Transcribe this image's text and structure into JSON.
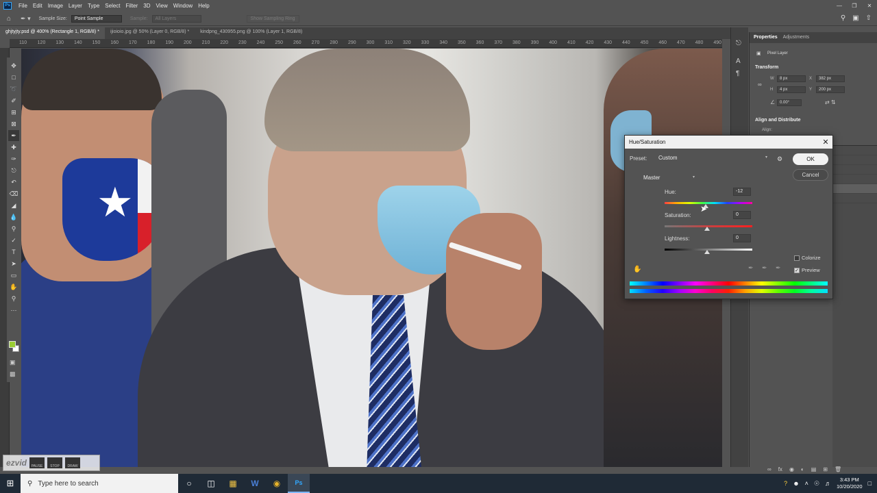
{
  "app": {
    "logo": "Ps",
    "menu": [
      "File",
      "Edit",
      "Image",
      "Layer",
      "Type",
      "Select",
      "Filter",
      "3D",
      "View",
      "Window",
      "Help"
    ]
  },
  "options_bar": {
    "sample_size_label": "Sample Size:",
    "sample_size_value": "Point Sample",
    "sample_label": "Sample:",
    "sample_value": "All Layers",
    "show_ring_label": "Show Sampling Ring"
  },
  "doc_tabs": [
    "ghjtyjty.psd @ 400% (Rectangle 1, RGB/8) *",
    "ijioioio.jpg @ 50% (Layer 0, RGB/8) *",
    "kindpng_430955.png @ 100% (Layer 1, RGB/8)"
  ],
  "ruler_ticks": [
    "110",
    "120",
    "130",
    "140",
    "150",
    "160",
    "170",
    "180",
    "190",
    "200",
    "210",
    "220",
    "230",
    "240",
    "250",
    "260",
    "270",
    "280",
    "290",
    "300",
    "310",
    "320",
    "330",
    "340",
    "350",
    "360",
    "370",
    "380",
    "390",
    "400",
    "410",
    "420",
    "430",
    "440",
    "450",
    "460",
    "470",
    "480",
    "490"
  ],
  "properties_panel": {
    "tab_properties": "Properties",
    "tab_adjustments": "Adjustments",
    "layer_type": "Pixel Layer",
    "transform_title": "Transform",
    "w_label": "W",
    "w_value": "8 px",
    "h_label": "H",
    "h_value": "4 px",
    "x_label": "X",
    "x_value": "382 px",
    "y_label": "Y",
    "y_value": "200 px",
    "angle_value": "0.00°",
    "align_title": "Align and Distribute",
    "align_label": "Align:"
  },
  "dialog": {
    "title": "Hue/Saturation",
    "preset_label": "Preset:",
    "preset_value": "Custom",
    "ok_label": "OK",
    "cancel_label": "Cancel",
    "channel_value": "Master",
    "hue_label": "Hue:",
    "hue_value": "-12",
    "saturation_label": "Saturation:",
    "saturation_value": "0",
    "lightness_label": "Lightness:",
    "lightness_value": "0",
    "colorize_label": "Colorize",
    "colorize_checked": false,
    "preview_label": "Preview",
    "preview_checked": true
  },
  "watermark": {
    "logo": "ezvid",
    "buttons": [
      "PAUSE",
      "STOP",
      "DRAW"
    ]
  },
  "taskbar": {
    "search_placeholder": "Type here to search",
    "time": "3:43 PM",
    "date": "10/20/2020"
  }
}
